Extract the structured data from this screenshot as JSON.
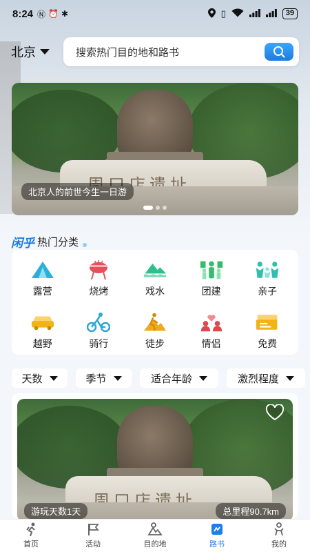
{
  "status_bar": {
    "time": "8:24",
    "battery": "39"
  },
  "header": {
    "city": "北京",
    "search_placeholder": "搜索热门目的地和路书"
  },
  "banner": {
    "caption": "北京人的前世今生一日游",
    "inscription": "周口店遗址",
    "page_count": 3,
    "active_index": 0
  },
  "section": {
    "logo": "闲乎",
    "title": "热门分类"
  },
  "categories": [
    {
      "label": "露营",
      "icon": "tent-icon",
      "color": "#2bb0d8"
    },
    {
      "label": "烧烤",
      "icon": "grill-icon",
      "color": "#e5505a"
    },
    {
      "label": "戏水",
      "icon": "water-icon",
      "color": "#2fbf8a"
    },
    {
      "label": "团建",
      "icon": "team-icon",
      "color": "#2fbf6a"
    },
    {
      "label": "亲子",
      "icon": "family-icon",
      "color": "#2fbfb0"
    },
    {
      "label": "越野",
      "icon": "car-icon",
      "color": "#f2b316"
    },
    {
      "label": "骑行",
      "icon": "bike-icon",
      "color": "#2aa6d9"
    },
    {
      "label": "徒步",
      "icon": "hiking-icon",
      "color": "#f0a81c"
    },
    {
      "label": "情侣",
      "icon": "couple-icon",
      "color": "#e0484e"
    },
    {
      "label": "免费",
      "icon": "ticket-icon",
      "color": "#f2b316"
    }
  ],
  "filters": [
    {
      "label": "天数"
    },
    {
      "label": "季节"
    },
    {
      "label": "适合年龄"
    },
    {
      "label": "激烈程度"
    }
  ],
  "route_card": {
    "days": "游玩天数1天",
    "distance": "总里程90.7km",
    "inscription": "周口店遗址"
  },
  "tabbar": {
    "active": "路书",
    "active_color": "#1e7ee8",
    "items": [
      {
        "label": "首页",
        "icon": "home-icon"
      },
      {
        "label": "活动",
        "icon": "flag-icon"
      },
      {
        "label": "目的地",
        "icon": "destination-icon"
      },
      {
        "label": "路书",
        "icon": "roadbook-icon"
      },
      {
        "label": "我的",
        "icon": "profile-icon"
      }
    ]
  }
}
